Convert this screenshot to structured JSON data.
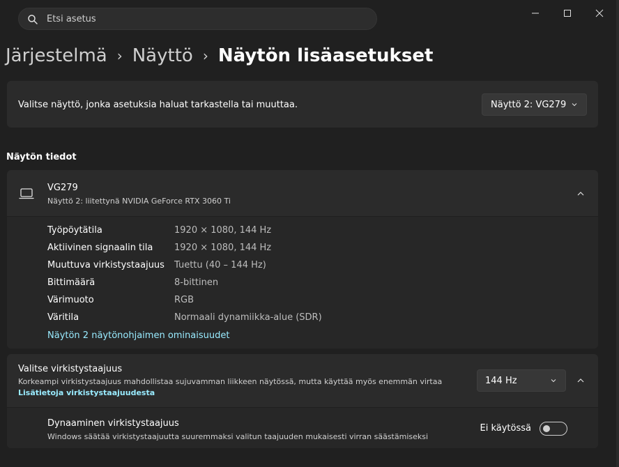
{
  "search": {
    "placeholder": "Etsi asetus"
  },
  "breadcrumb": {
    "items": [
      "Järjestelmä",
      "Näyttö",
      "Näytön lisäasetukset"
    ]
  },
  "display_select": {
    "label": "Valitse näyttö, jonka asetuksia haluat tarkastella tai muuttaa.",
    "selected": "Näyttö 2: VG279"
  },
  "display_info": {
    "heading": "Näytön tiedot",
    "name": "VG279",
    "subtitle": "Näyttö 2: liitettynä NVIDIA GeForce RTX 3060 Ti",
    "rows": [
      {
        "key": "Työpöytätila",
        "value": "1920 × 1080, 144 Hz"
      },
      {
        "key": "Aktiivinen signaalin tila",
        "value": "1920 × 1080, 144 Hz"
      },
      {
        "key": "Muuttuva virkistystaajuus",
        "value": "Tuettu (40 – 144 Hz)"
      },
      {
        "key": "Bittimäärä",
        "value": "8-bittinen"
      },
      {
        "key": "Värimuoto",
        "value": "RGB"
      },
      {
        "key": "Väritila",
        "value": "Normaali dynamiikka-alue (SDR)"
      }
    ],
    "adapter_link": "Näytön 2 näytönohjaimen ominaisuudet"
  },
  "refresh_rate": {
    "title": "Valitse virkistystaajuus",
    "description": "Korkeampi virkistystaajuus mahdollistaa sujuvamman liikkeen näytössä, mutta käyttää myös enemmän virtaa",
    "link": "Lisätietoja virkistystaajuudesta",
    "selected": "144 Hz"
  },
  "dynamic_refresh": {
    "title": "Dynaaminen virkistystaajuus",
    "description": "Windows säätää virkistystaajuutta suuremmaksi valitun taajuuden mukaisesti virran säästämiseksi",
    "state_label": "Ei käytössä",
    "enabled": false
  },
  "colors": {
    "accent_link": "#99ebff",
    "background": "#202020",
    "card": "#2b2b2b"
  }
}
